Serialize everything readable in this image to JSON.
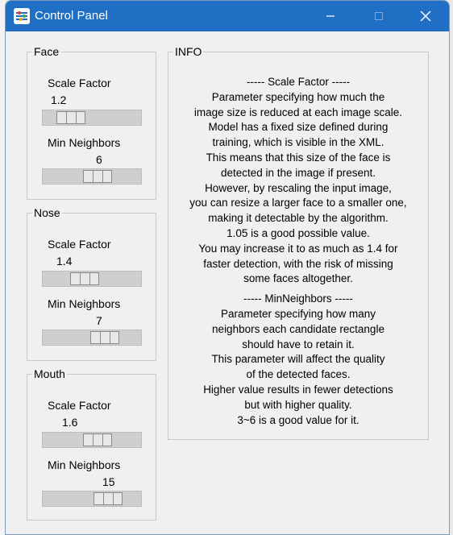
{
  "window": {
    "title": "Control Panel",
    "accent_color": "#1f6fc4",
    "icons": [
      "control-panel-icon",
      "minimize-icon",
      "maximize-icon",
      "close-icon"
    ]
  },
  "face": {
    "title": "Face",
    "scale_label": "Scale Factor",
    "scale_value": "1.2",
    "scale_slider_fraction": 0.2,
    "neighbors_label": "Min Neighbors",
    "neighbors_value": "6",
    "neighbors_slider_fraction": 0.6
  },
  "nose": {
    "title": "Nose",
    "scale_label": "Scale Factor",
    "scale_value": "1.4",
    "scale_slider_fraction": 0.4,
    "neighbors_label": "Min Neighbors",
    "neighbors_value": "7",
    "neighbors_slider_fraction": 0.7
  },
  "mouth": {
    "title": "Mouth",
    "scale_label": "Scale Factor",
    "scale_value": "1.6",
    "scale_slider_fraction": 0.6,
    "neighbors_label": "Min Neighbors",
    "neighbors_value": "15",
    "neighbors_slider_fraction": 0.75
  },
  "info": {
    "title": "INFO",
    "lines": [
      "----- Scale Factor -----",
      "Parameter specifying how much the",
      "image size is reduced at each image scale.",
      "Model has a fixed size defined during",
      "training, which is visible in the XML.",
      "This means that this size of the face is",
      "detected in the image if present.",
      "However, by rescaling the input image,",
      "you can resize a larger face to a smaller one,",
      "making it detectable by the algorithm.",
      "1.05 is a good possible value.",
      "You may increase it to as much as 1.4 for",
      "faster detection, with the risk of missing",
      "some faces altogether.",
      "----- MinNeighbors -----",
      "Parameter specifying how many",
      "neighbors each candidate rectangle",
      "should have to retain it.",
      "This parameter will affect the quality",
      "of the detected faces.",
      "Higher value results in fewer detections",
      "but with higher quality.",
      "3~6 is a good value for it."
    ]
  }
}
